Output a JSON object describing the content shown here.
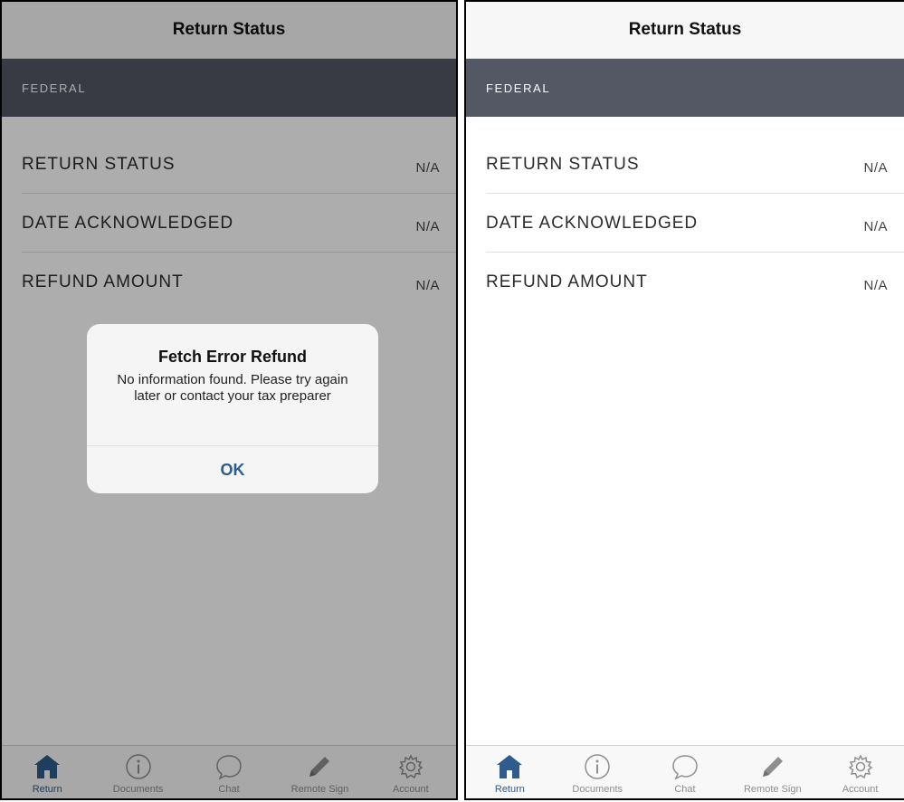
{
  "screens": [
    {
      "nav_title": "Return Status",
      "section_label": "FEDERAL",
      "rows": [
        {
          "label": "RETURN STATUS",
          "value": "N/A"
        },
        {
          "label": "DATE ACKNOWLEDGED",
          "value": "N/A"
        },
        {
          "label": "REFUND AMOUNT",
          "value": "N/A"
        }
      ],
      "alert": {
        "title": "Fetch Error Refund",
        "message": "No information found. Please try again later or contact your tax preparer",
        "ok_label": "OK"
      },
      "tabs": [
        {
          "label": "Return",
          "icon": "home-icon",
          "active": true
        },
        {
          "label": "Documents",
          "icon": "info-icon",
          "active": false
        },
        {
          "label": "Chat",
          "icon": "chat-bubble-icon",
          "active": false
        },
        {
          "label": "Remote Sign",
          "icon": "pencil-icon",
          "active": false
        },
        {
          "label": "Account",
          "icon": "gear-icon",
          "active": false
        }
      ]
    },
    {
      "nav_title": "Return Status",
      "section_label": "FEDERAL",
      "rows": [
        {
          "label": "RETURN STATUS",
          "value": "N/A"
        },
        {
          "label": "DATE ACKNOWLEDGED",
          "value": "N/A"
        },
        {
          "label": "REFUND AMOUNT",
          "value": "N/A"
        }
      ],
      "tabs": [
        {
          "label": "Return",
          "icon": "home-icon",
          "active": true
        },
        {
          "label": "Documents",
          "icon": "info-icon",
          "active": false
        },
        {
          "label": "Chat",
          "icon": "chat-bubble-icon",
          "active": false
        },
        {
          "label": "Remote Sign",
          "icon": "pencil-icon",
          "active": false
        },
        {
          "label": "Account",
          "icon": "gear-icon",
          "active": false
        }
      ]
    }
  ],
  "colors": {
    "accent": "#2f5c8a",
    "section_header_bg": "#535864",
    "inactive_tab": "#8e8e8e"
  }
}
